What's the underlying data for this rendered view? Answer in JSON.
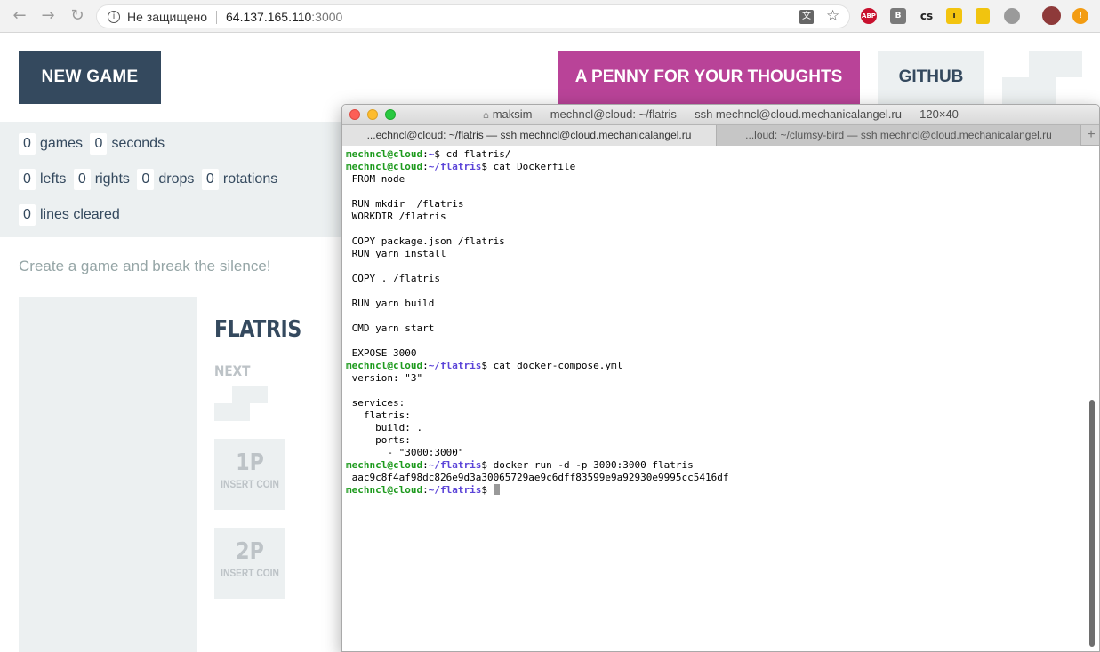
{
  "browser": {
    "security_label": "Не защищено",
    "url_host": "64.137.165.110",
    "url_port": ":3000",
    "extensions": [
      "ABP",
      "B",
      "cs",
      "ı"
    ]
  },
  "header": {
    "new_game_label": "NEW GAME",
    "penny_label": "A PENNY FOR YOUR THOUGHTS",
    "github_label": "GITHUB"
  },
  "stats": {
    "games": {
      "value": "0",
      "label": "games"
    },
    "seconds": {
      "value": "0",
      "label": "seconds"
    },
    "lefts": {
      "value": "0",
      "label": "lefts"
    },
    "rights": {
      "value": "0",
      "label": "rights"
    },
    "drops": {
      "value": "0",
      "label": "drops"
    },
    "rotations": {
      "value": "0",
      "label": "rotations"
    },
    "lines": {
      "value": "0",
      "label": "lines cleared"
    }
  },
  "main": {
    "silence_text": "Create a game and break the silence!",
    "game_title": "FLATRIS",
    "next_label": "NEXT",
    "player1": {
      "label": "1P",
      "sub": "INSERT COIN"
    },
    "player2": {
      "label": "2P",
      "sub": "INSERT COIN"
    }
  },
  "terminal": {
    "title": "maksim — mechncl@cloud: ~/flatris — ssh mechncl@cloud.mechanicalangel.ru — 120×40",
    "tabs": [
      {
        "label": "...echncl@cloud: ~/flatris — ssh mechncl@cloud.mechanicalangel.ru"
      },
      {
        "label": "...loud: ~/clumsy-bird — ssh mechncl@cloud.mechanicalangel.ru"
      }
    ],
    "new_tab_label": "+",
    "prompt_user": "mechncl@cloud",
    "lines": [
      {
        "prompt": true,
        "path": "~",
        "cmd": "$ cd flatris/"
      },
      {
        "prompt": true,
        "path": "~/flatris",
        "cmd": "$ cat Dockerfile"
      },
      {
        "text": "FROM node"
      },
      {
        "text": ""
      },
      {
        "text": "RUN mkdir  /flatris"
      },
      {
        "text": "WORKDIR /flatris"
      },
      {
        "text": ""
      },
      {
        "text": "COPY package.json /flatris"
      },
      {
        "text": "RUN yarn install"
      },
      {
        "text": ""
      },
      {
        "text": "COPY . /flatris"
      },
      {
        "text": ""
      },
      {
        "text": "RUN yarn build"
      },
      {
        "text": ""
      },
      {
        "text": "CMD yarn start"
      },
      {
        "text": ""
      },
      {
        "text": "EXPOSE 3000"
      },
      {
        "prompt": true,
        "path": "~/flatris",
        "cmd": "$ cat docker-compose.yml"
      },
      {
        "text": "version: \"3\""
      },
      {
        "text": ""
      },
      {
        "text": "services:"
      },
      {
        "text": "  flatris:"
      },
      {
        "text": "    build: ."
      },
      {
        "text": "    ports:"
      },
      {
        "text": "      - \"3000:3000\""
      },
      {
        "prompt": true,
        "path": "~/flatris",
        "cmd": "$ docker run -d -p 3000:3000 flatris"
      },
      {
        "text": "aac9c8f4af98dc826e9d3a30065729ae9c6dff83599e9a92930e9995cc5416df"
      },
      {
        "prompt": true,
        "path": "~/flatris",
        "cmd": "$ ",
        "cursor": true
      }
    ]
  }
}
